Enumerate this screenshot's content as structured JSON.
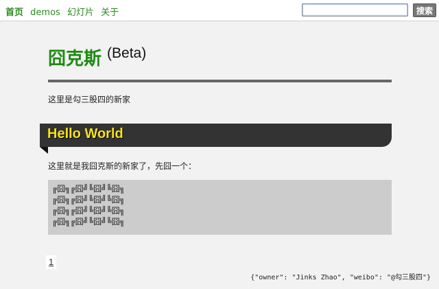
{
  "nav": {
    "items": [
      {
        "label": "首页",
        "active": true
      },
      {
        "label": "demos",
        "active": false
      },
      {
        "label": "幻灯片",
        "active": false
      },
      {
        "label": "关于",
        "active": false
      }
    ],
    "link_color": "#2b8a1e"
  },
  "search": {
    "value": "",
    "placeholder": "",
    "button_label": "搜索"
  },
  "site": {
    "title": "囧克斯",
    "badge": "(Beta)",
    "subtitle": "这里是勾三股四的新家",
    "title_color": "#1f8a14"
  },
  "post": {
    "title": "Hello World",
    "title_color": "#f6e41c",
    "intro": "这里就是我囧克斯的新家了，先囧一个：",
    "code_lines": [
      "╔囧╗╔囧╝╚囧╝╚囧╗",
      "╔囧╗╔囧╝╚囧╝╚囧╗",
      "╔囧╗╔囧╝╚囧╝╚囧╗",
      "╔囧╗╔囧╝╚囧╝╚囧╗"
    ]
  },
  "pagination": {
    "current_page": "1"
  },
  "footer": {
    "text": "{\"owner\": \"Jinks Zhao\", \"weibo\": \"@勾三股四\"}"
  }
}
